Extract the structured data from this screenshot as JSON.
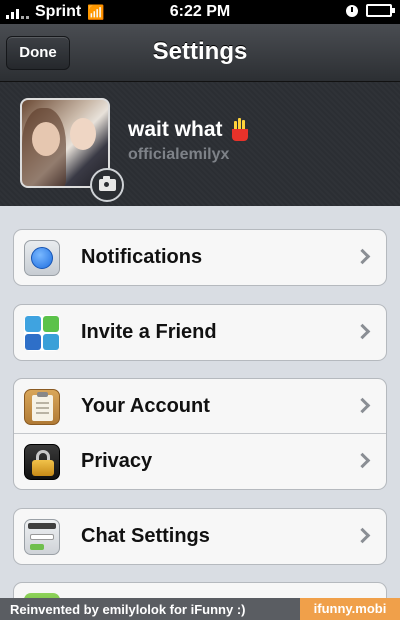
{
  "status_bar": {
    "carrier": "Sprint",
    "time": "6:22 PM"
  },
  "nav": {
    "done_label": "Done",
    "title": "Settings"
  },
  "profile": {
    "name": "wait what",
    "username": "officialemilyx",
    "name_emoji_icon": "french-fries-icon"
  },
  "groups": [
    {
      "rows": [
        {
          "label": "Notifications",
          "icon": "notification-dot-icon"
        }
      ]
    },
    {
      "rows": [
        {
          "label": "Invite a Friend",
          "icon": "invite-apps-icon"
        }
      ]
    },
    {
      "rows": [
        {
          "label": "Your Account",
          "icon": "clipboard-icon"
        },
        {
          "label": "Privacy",
          "icon": "padlock-icon"
        }
      ]
    },
    {
      "rows": [
        {
          "label": "Chat Settings",
          "icon": "chat-settings-icon"
        }
      ]
    }
  ],
  "watermark": {
    "text": "Reinvented by emilylolok for iFunny :)",
    "brand": "ifunny.mobi"
  }
}
